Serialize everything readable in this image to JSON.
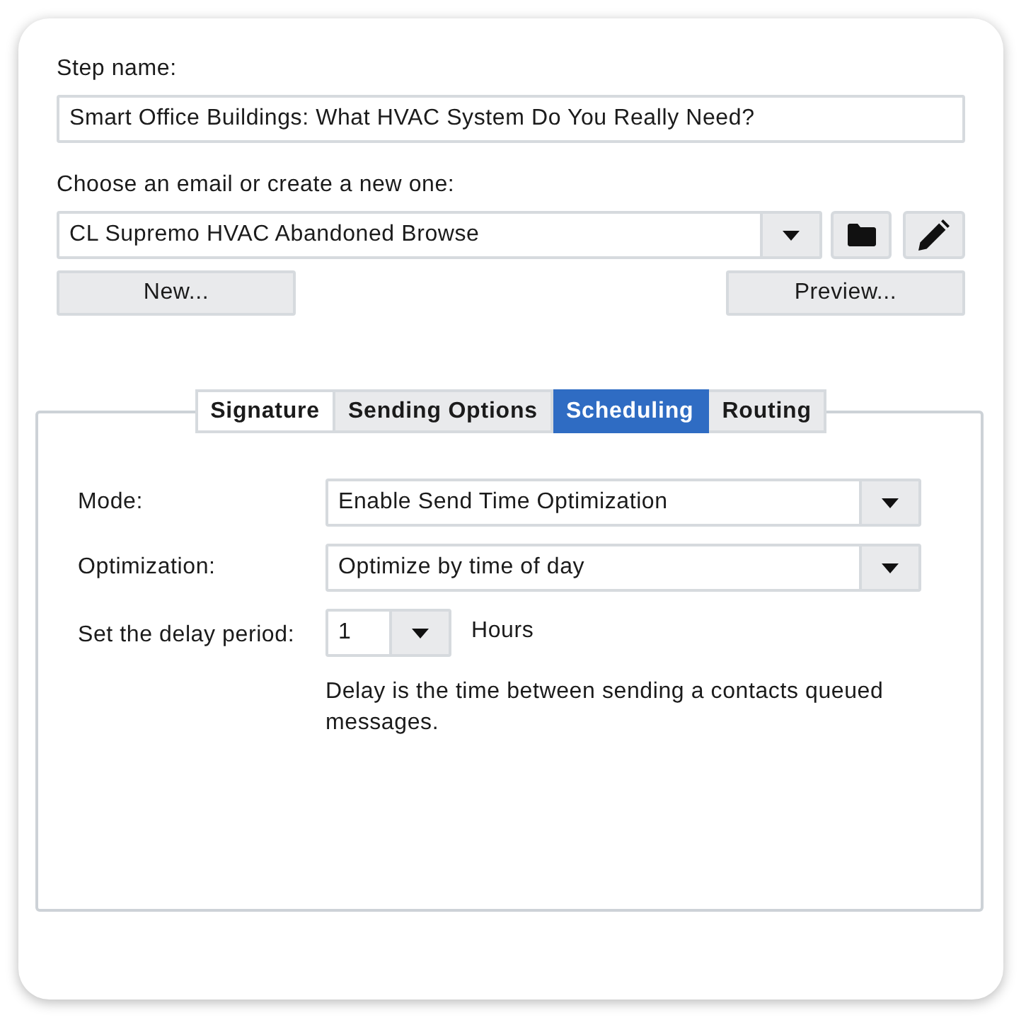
{
  "step_name": {
    "label": "Step name:",
    "value": "Smart Office Buildings: What HVAC System Do You Really Need?"
  },
  "email": {
    "label": "Choose an email or create a new one:",
    "value": "CL Supremo HVAC Abandoned Browse",
    "buttons": [
      "New...",
      "Preview..."
    ]
  },
  "tabs": [
    {
      "label": "Signature",
      "selected": false,
      "hovered": true
    },
    {
      "label": "Sending Options",
      "selected": false,
      "hovered": false
    },
    {
      "label": "Scheduling",
      "selected": true,
      "hovered": false
    },
    {
      "label": "Routing",
      "selected": false,
      "hovered": false
    }
  ],
  "scheduling": {
    "rows": [
      {
        "kind": "select",
        "label": "Mode:",
        "value": "Enable Send Time Optimization"
      },
      {
        "kind": "select",
        "label": "Optimization:",
        "value": "Optimize by time of day"
      },
      {
        "kind": "number_select",
        "label": "Set the delay period:",
        "value": "1",
        "unit": "Hours"
      }
    ],
    "note": "Delay is the time between sending a contacts queued messages."
  }
}
